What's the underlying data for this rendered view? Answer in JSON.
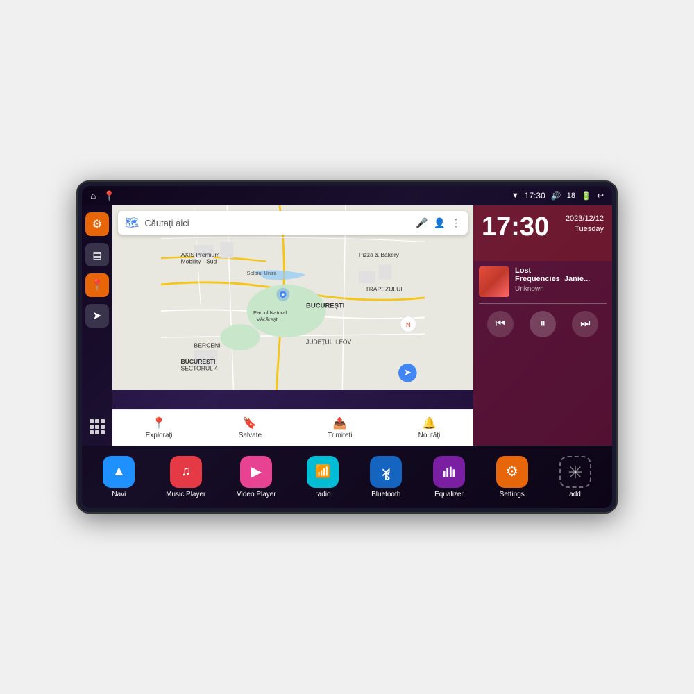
{
  "device": {
    "status_bar": {
      "left_icons": [
        "home",
        "location"
      ],
      "time": "17:30",
      "right_icons": [
        "wifi",
        "volume",
        "18",
        "battery",
        "back"
      ]
    },
    "clock": {
      "time": "17:30",
      "date_line1": "2023/12/12",
      "date_line2": "Tuesday"
    },
    "music": {
      "title": "Lost Frequencies_Janie...",
      "artist": "Unknown",
      "controls": {
        "prev": "⏮",
        "play_pause": "⏸",
        "next": "⏭"
      }
    },
    "map": {
      "search_placeholder": "Căutați aici",
      "locations": [
        "AXIS Premium Mobility - Sud",
        "Pizza & Bakery",
        "Parcul Natural Văcărești",
        "BUCUREȘTI",
        "SECTORUL 4",
        "BUCUREȘTI",
        "IUDEȚUL ILFOV",
        "TRAPEZULUI",
        "BERCENI"
      ],
      "nav_items": [
        {
          "label": "Explorați",
          "icon": "📍"
        },
        {
          "label": "Salvate",
          "icon": "🔖"
        },
        {
          "label": "Trimiteți",
          "icon": "📤"
        },
        {
          "label": "Noutăți",
          "icon": "🔔"
        }
      ]
    },
    "sidebar": {
      "buttons": [
        "settings",
        "layers",
        "location",
        "navigation"
      ]
    },
    "apps": [
      {
        "label": "Navi",
        "color": "blue",
        "icon": "▲"
      },
      {
        "label": "Music Player",
        "color": "red",
        "icon": "♪"
      },
      {
        "label": "Video Player",
        "color": "pink",
        "icon": "▶"
      },
      {
        "label": "radio",
        "color": "teal",
        "icon": "📶"
      },
      {
        "label": "Bluetooth",
        "color": "bt",
        "icon": "⬡"
      },
      {
        "label": "Equalizer",
        "color": "eq",
        "icon": "≡"
      },
      {
        "label": "Settings",
        "color": "orange",
        "icon": "⚙"
      },
      {
        "label": "add",
        "color": "gray-outline",
        "icon": "+"
      }
    ]
  }
}
